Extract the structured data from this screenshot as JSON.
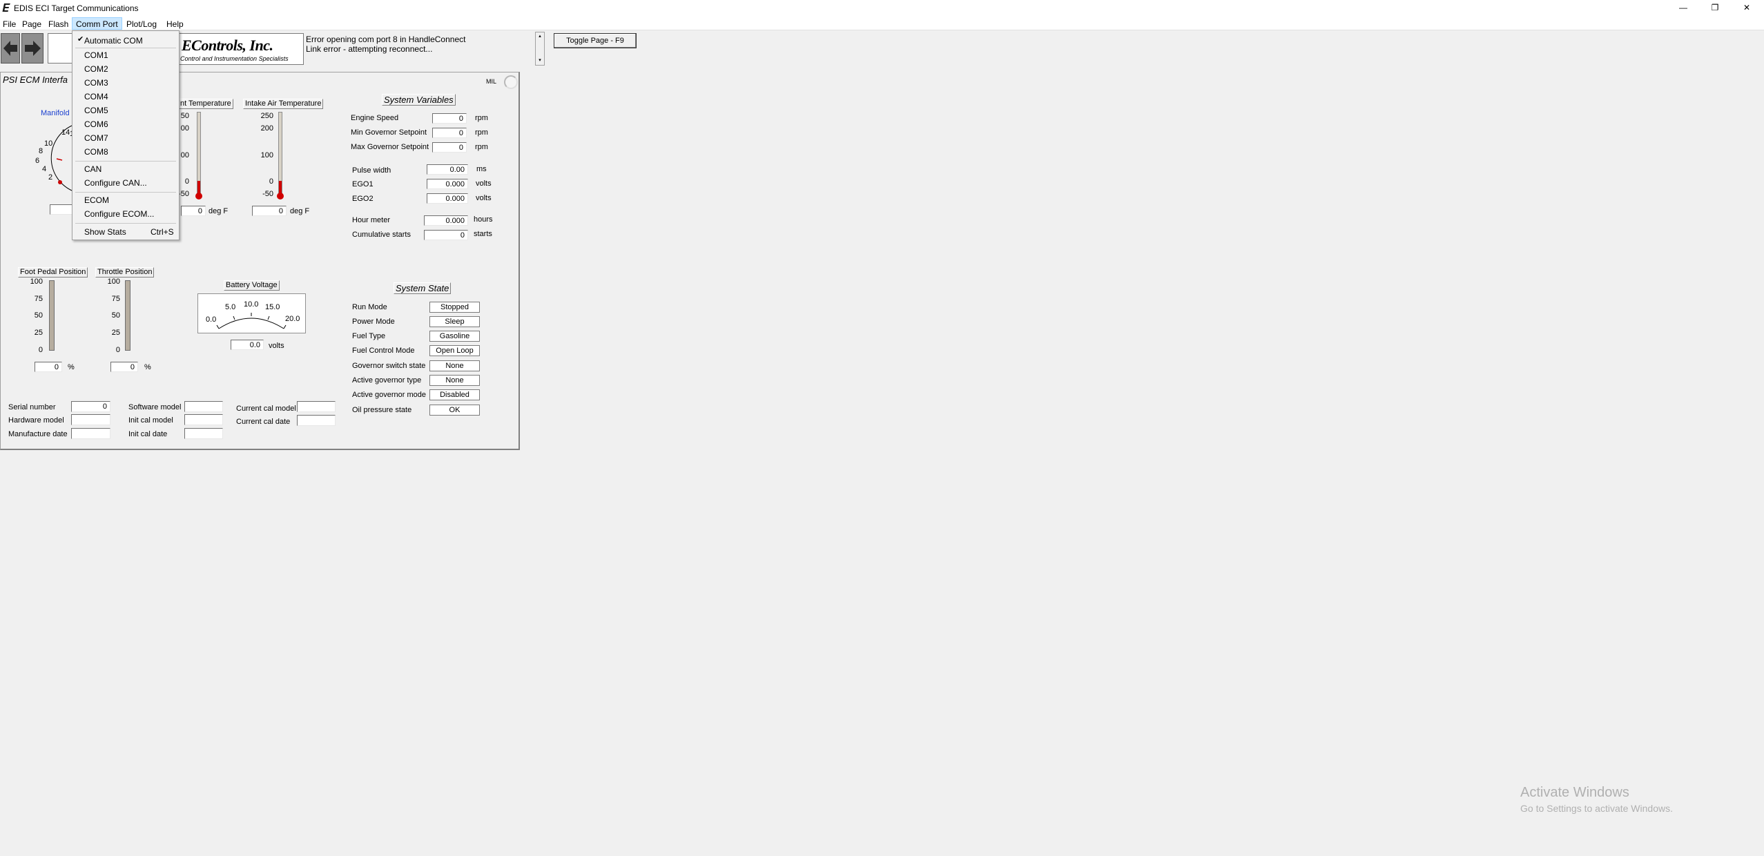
{
  "window": {
    "title": "EDIS ECI Target Communications",
    "app_icon": "app-logo-e",
    "minimize": "—",
    "restore": "❐",
    "close": "✕"
  },
  "menubar": {
    "file": "File",
    "page": "Page",
    "flash": "Flash",
    "comm_port": "Comm Port",
    "plot_log": "Plot/Log",
    "help": "Help"
  },
  "comm_menu": {
    "check": "✔",
    "items": [
      "Automatic COM",
      "COM1",
      "COM2",
      "COM3",
      "COM4",
      "COM5",
      "COM6",
      "COM7",
      "COM8",
      "CAN",
      "Configure CAN...",
      "ECOM",
      "Configure ECOM...",
      "Show Stats"
    ],
    "shortcut": "Ctrl+S"
  },
  "toolbar": {
    "back_icon": "arrow-left-icon",
    "forward_icon": "arrow-right-icon",
    "logo_name": "EControls, Inc.",
    "logo_tagline": "Control and Instrumentation Specialists",
    "status_lines": [
      "Error opening com port 8 in HandleConnect",
      "Link error - attempting reconnect..."
    ],
    "toggle_page": "Toggle Page - F9"
  },
  "panel": {
    "title": "PSI ECM Interfa",
    "mil": "MIL"
  },
  "manifold": {
    "label": "Manifold",
    "ticks": [
      "14",
      "10",
      "8",
      "6",
      "4",
      "2"
    ],
    "marker": "1"
  },
  "coolant": {
    "title": "nt Temperature",
    "ticks": [
      "50",
      "00",
      "00",
      "0",
      "-50"
    ],
    "value": "0",
    "unit": "deg F",
    "level": 0.05
  },
  "iat": {
    "title": "Intake Air Temperature",
    "ticks": [
      "250",
      "200",
      "100",
      "0",
      "-50"
    ],
    "value": "0",
    "unit": "deg F",
    "level": 0.05
  },
  "foot_pedal": {
    "title": "Foot Pedal Position",
    "ticks": [
      "100",
      "75",
      "50",
      "25",
      "0"
    ],
    "value": "0",
    "unit": "%",
    "level": 0
  },
  "throttle": {
    "title": "Throttle Position",
    "ticks": [
      "100",
      "75",
      "50",
      "25",
      "0"
    ],
    "value": "0",
    "unit": "%",
    "level": 0
  },
  "battery": {
    "title": "Battery Voltage",
    "ticks": [
      "0.0",
      "5.0",
      "10.0",
      "15.0",
      "20.0"
    ],
    "value": "0.0",
    "unit": "volts"
  },
  "system_variables": {
    "title": "System Variables",
    "rows": [
      {
        "label": "Engine Speed",
        "value": "0",
        "unit": "rpm"
      },
      {
        "label": "Min Governor Setpoint",
        "value": "0",
        "unit": "rpm"
      },
      {
        "label": "Max Governor Setpoint",
        "value": "0",
        "unit": "rpm"
      },
      {
        "label": "Pulse width",
        "value": "0.00",
        "unit": "ms"
      },
      {
        "label": "EGO1",
        "value": "0.000",
        "unit": "volts"
      },
      {
        "label": "EGO2",
        "value": "0.000",
        "unit": "volts"
      },
      {
        "label": "Hour meter",
        "value": "0.000",
        "unit": "hours"
      },
      {
        "label": "Cumulative starts",
        "value": "0",
        "unit": "starts"
      }
    ]
  },
  "system_state": {
    "title": "System State",
    "rows": [
      {
        "label": "Run Mode",
        "value": "Stopped"
      },
      {
        "label": "Power Mode",
        "value": "Sleep"
      },
      {
        "label": "Fuel Type",
        "value": "Gasoline"
      },
      {
        "label": "Fuel Control Mode",
        "value": "Open Loop"
      },
      {
        "label": "Governor switch state",
        "value": "None"
      },
      {
        "label": "Active governor type",
        "value": "None"
      },
      {
        "label": "Active governor mode",
        "value": "Disabled"
      },
      {
        "label": "Oil pressure state",
        "value": "OK"
      }
    ]
  },
  "info": {
    "serial_number": "Serial number",
    "serial_value": "0",
    "hardware_model": "Hardware model",
    "manufacture_date": "Manufacture date",
    "software_model": "Software model",
    "init_cal_model": "Init cal model",
    "init_cal_date": "Init cal date",
    "current_cal_model": "Current cal model",
    "current_cal_date": "Current cal date"
  },
  "watermark": {
    "line1": "Activate Windows",
    "line2": "Go to Settings to activate Windows."
  }
}
